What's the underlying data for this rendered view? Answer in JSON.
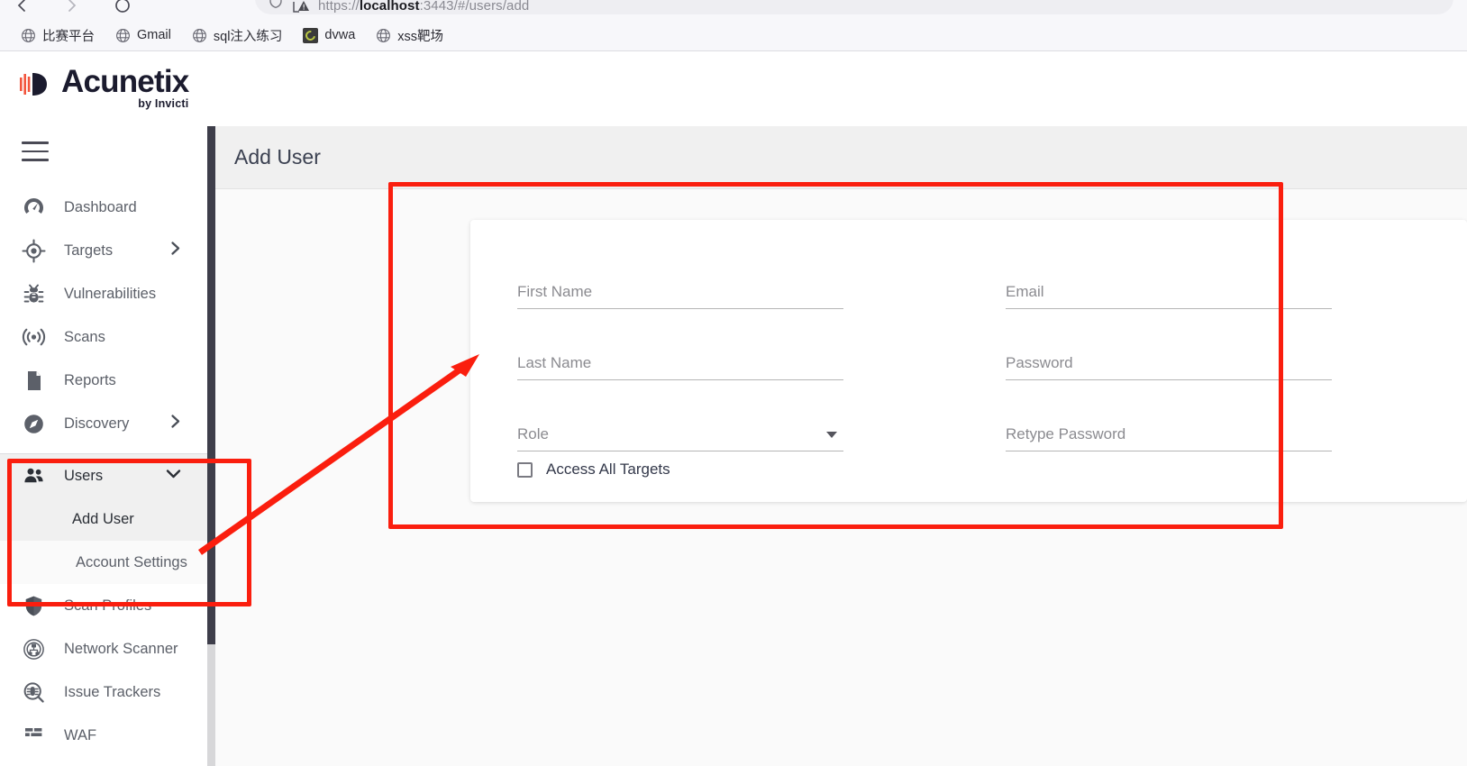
{
  "browser": {
    "back_icon": "back-arrow-icon",
    "forward_icon": "forward-arrow-icon",
    "reload_icon": "reload-icon",
    "shield_icon": "shield-icon",
    "security_icon": "insecure-connection-warning-icon",
    "url_scheme": "https://",
    "url_host": "localhost",
    "url_rest": ":3443/#/users/add",
    "bookmarks": [
      {
        "label": "比赛平台",
        "icon": "globe-icon"
      },
      {
        "label": "Gmail",
        "icon": "globe-icon"
      },
      {
        "label": "sql注入练习",
        "icon": "globe-icon"
      },
      {
        "label": "dvwa",
        "icon": "dvwa-favicon"
      },
      {
        "label": "xss靶场",
        "icon": "globe-icon"
      }
    ]
  },
  "brand": {
    "name": "Acunetix",
    "tagline": "by Invicti",
    "logo_icon": "acunetix-logo-icon"
  },
  "sidebar": {
    "menu_icon": "hamburger-menu-icon",
    "items": [
      {
        "label": "Dashboard",
        "icon": "dashboard-gauge-icon",
        "chevron": null
      },
      {
        "label": "Targets",
        "icon": "target-crosshair-icon",
        "chevron": "chevron-right-icon"
      },
      {
        "label": "Vulnerabilities",
        "icon": "bug-icon",
        "chevron": null
      },
      {
        "label": "Scans",
        "icon": "scan-radar-icon",
        "chevron": null
      },
      {
        "label": "Reports",
        "icon": "document-icon",
        "chevron": null
      },
      {
        "label": "Discovery",
        "icon": "compass-icon",
        "chevron": "chevron-right-icon"
      }
    ],
    "users_group": {
      "label": "Users",
      "icon": "users-group-icon",
      "chevron": "chevron-down-icon",
      "expanded": true,
      "children": [
        {
          "label": "Add User",
          "active": true
        },
        {
          "label": "Account Settings",
          "active": false
        }
      ]
    },
    "items_after": [
      {
        "label": "Scan Profiles",
        "icon": "shield-icon"
      },
      {
        "label": "Network Scanner",
        "icon": "network-scanner-icon"
      },
      {
        "label": "Issue Trackers",
        "icon": "issue-tracker-magnifier-icon"
      },
      {
        "label": "WAF",
        "icon": "waf-grid-icon"
      }
    ],
    "scrollbar": "vertical-scrollbar"
  },
  "page": {
    "title": "Add User"
  },
  "form": {
    "left_column": [
      {
        "label": "First Name",
        "value": "",
        "type": "text",
        "name": "first-name-field"
      },
      {
        "label": "Last Name",
        "value": "",
        "type": "text",
        "name": "last-name-field"
      },
      {
        "label": "Role",
        "value": "",
        "type": "select",
        "name": "role-select",
        "caret": "dropdown-caret-icon"
      }
    ],
    "right_column": [
      {
        "label": "Email",
        "value": "",
        "type": "text",
        "name": "email-field"
      },
      {
        "label": "Password",
        "value": "",
        "type": "password",
        "name": "password-field"
      },
      {
        "label": "Retype Password",
        "value": "",
        "type": "password",
        "name": "retype-password-field"
      }
    ],
    "checkbox": {
      "label": "Access All Targets",
      "checked": false
    }
  },
  "annotations": {
    "color": "#fa1e0e",
    "form_box": "highlight-rectangle-form",
    "sidebar_box": "highlight-rectangle-users-menu",
    "arrow": "pointer-arrow-from-add-user-to-form"
  }
}
